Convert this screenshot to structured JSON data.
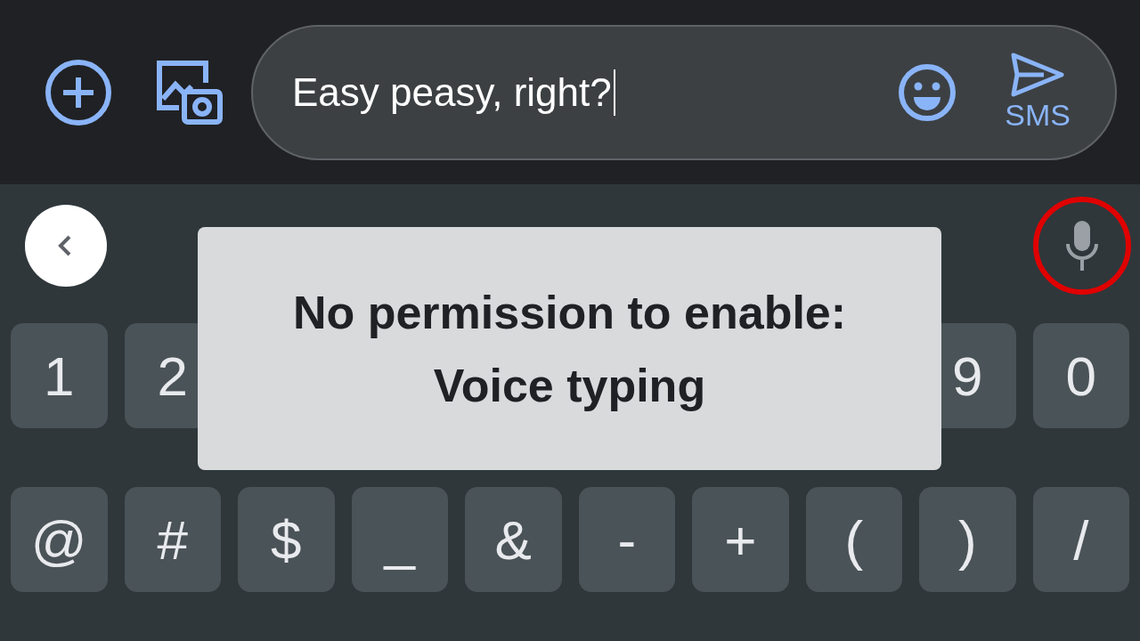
{
  "composer": {
    "actions": [
      {
        "kind": "add"
      },
      {
        "kind": "gallery"
      }
    ],
    "message_field": {
      "value": "Easy peasy, right?"
    },
    "send": {
      "label": "SMS"
    }
  },
  "toolbar": {
    "items": [
      {
        "kind": "back"
      },
      {
        "kind": "mic",
        "highlighted": true
      }
    ]
  },
  "key_rows": [
    {
      "start": [
        "1",
        "2"
      ],
      "end": [
        "9",
        "0"
      ]
    },
    {
      "start": [
        "@",
        "#",
        "$",
        "_",
        "&",
        "-",
        "+",
        "(",
        ")",
        "/"
      ],
      "end": []
    }
  ],
  "toast": {
    "lines": [
      "No permission to enable:",
      "Voice typing"
    ]
  }
}
